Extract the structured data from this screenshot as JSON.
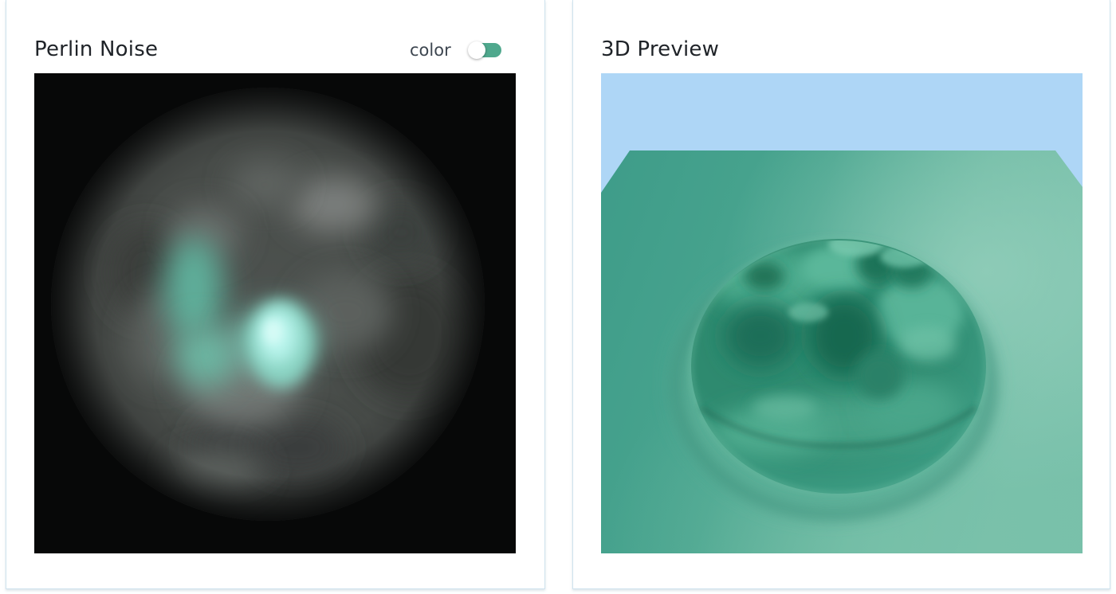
{
  "panels": {
    "noise": {
      "title": "Perlin Noise",
      "toggle": {
        "label": "color",
        "enabled": true,
        "on_color": "#4fa88d"
      }
    },
    "preview": {
      "title": "3D Preview"
    }
  },
  "colors": {
    "card_border": "#cfe3ee",
    "noise_background": "#070808",
    "noise_highlight": "#b8f4ec",
    "sky": "#aed6f6",
    "ground": "#3f9d8b",
    "ground_light": "#6fbaa4"
  }
}
